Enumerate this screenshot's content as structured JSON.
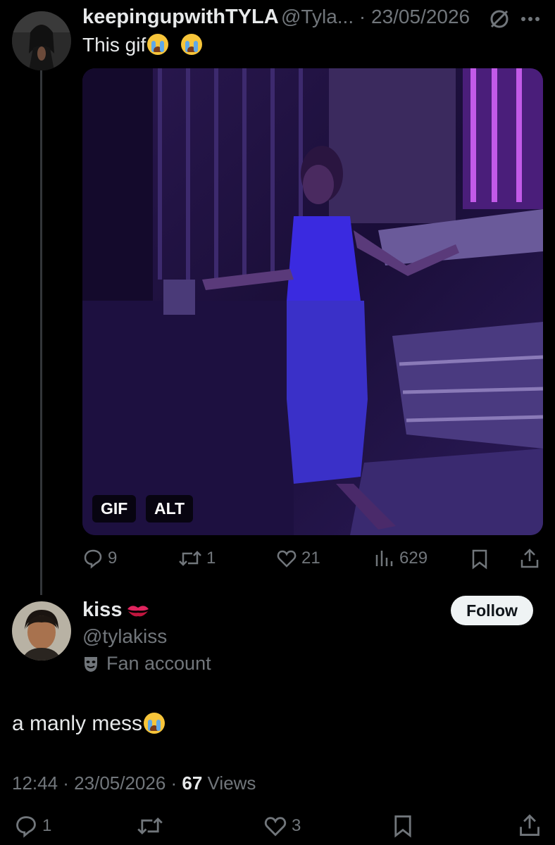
{
  "tweet": {
    "display_name": "keepingupwithTYLA",
    "handle_date": "@Tyla... · 23/05/2026",
    "text": "This gif",
    "media": {
      "gif_badge": "GIF",
      "alt_badge": "ALT"
    },
    "actions": {
      "replies": "9",
      "reposts": "1",
      "likes": "21",
      "views": "629"
    }
  },
  "reply": {
    "display_name": "kiss",
    "handle": "@tylakiss",
    "label": "Fan account",
    "follow_label": "Follow",
    "text": "a manly mess",
    "timestamp": "12:44 · 23/05/2026 · ",
    "views_count": "67",
    "views_label": " Views",
    "actions": {
      "replies": "1",
      "reposts": "",
      "likes": "3"
    }
  },
  "colors": {
    "background": "#000000",
    "text": "#e7e9ea",
    "muted": "#71767b",
    "follow_bg": "#eff3f4"
  }
}
